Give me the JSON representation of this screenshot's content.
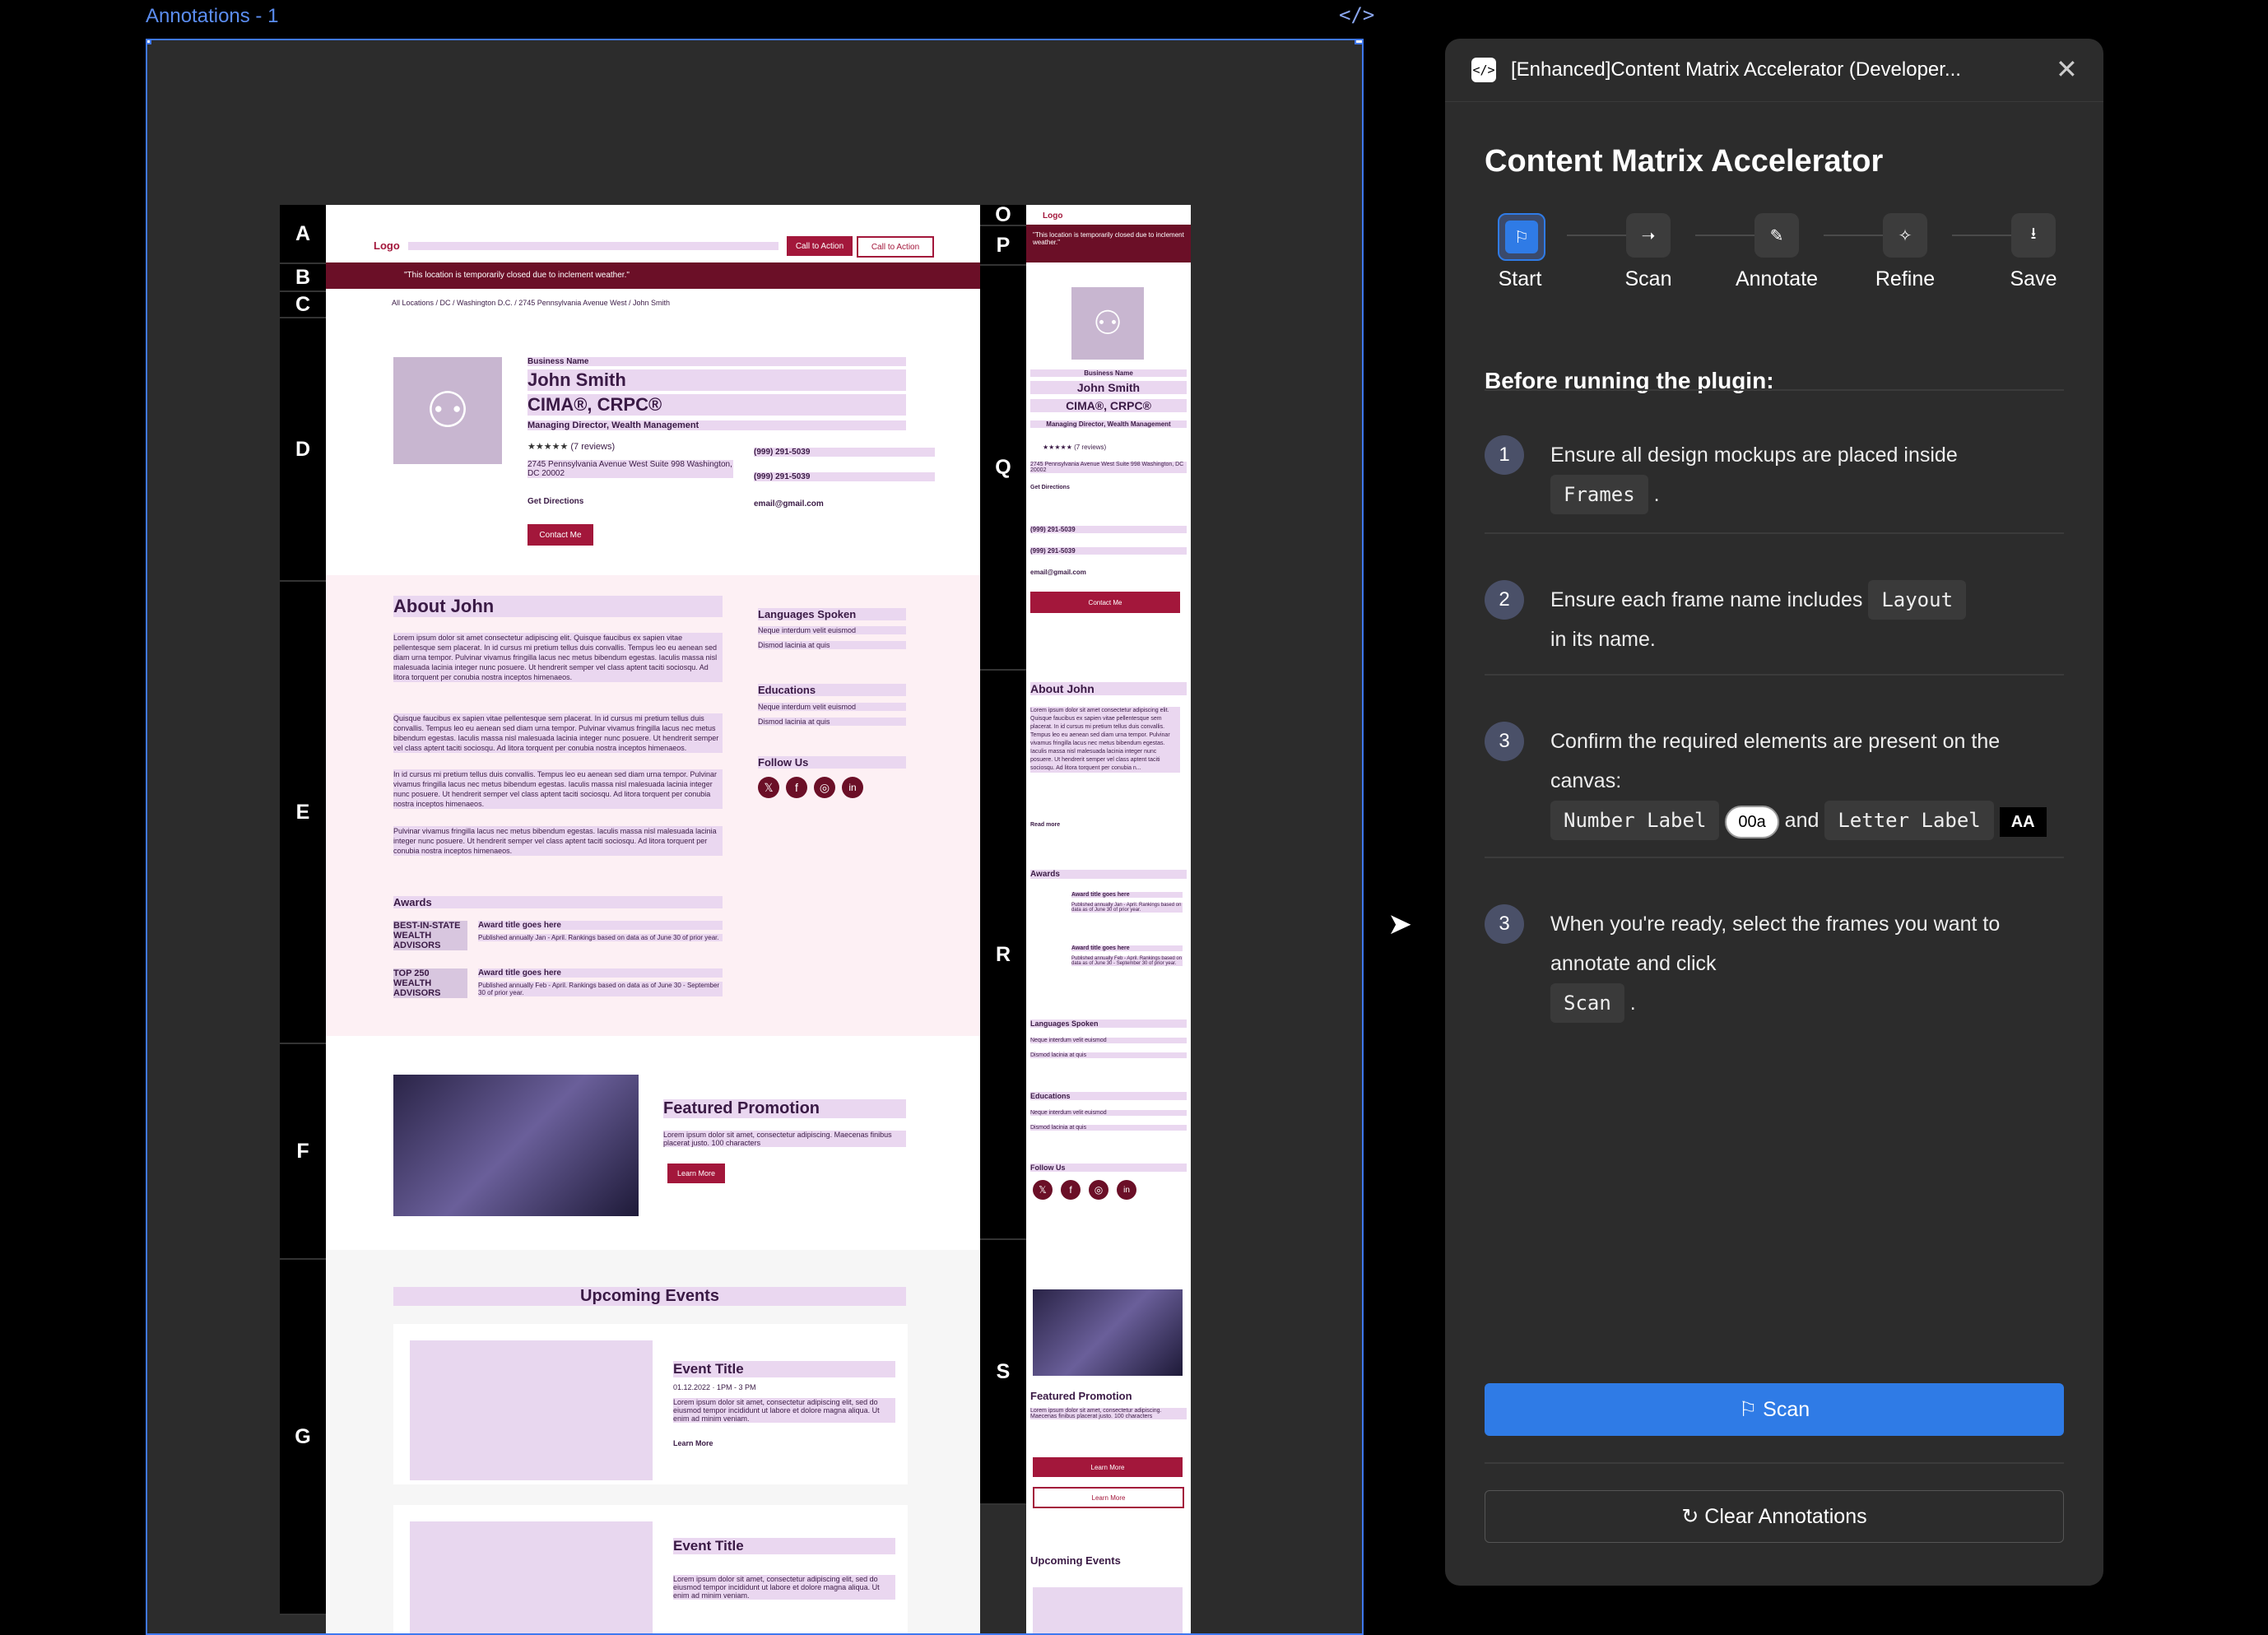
{
  "canvas": {
    "frame_label": "Annotations - 1",
    "code_toggle": "</>",
    "desktop_section_letters": [
      "A",
      "B",
      "C",
      "D",
      "E",
      "F",
      "G"
    ],
    "mobile_section_letters": [
      "O",
      "P",
      "Q",
      "R",
      "S"
    ],
    "desktop": {
      "logo": "Logo",
      "cta1": "Call to Action",
      "cta2": "Call to Action",
      "alert": "\"This location is temporarily closed due to inclement weather.\"",
      "breadcrumb": "All Locations / DC / Washington D.C. / 2745 Pennsylvania Avenue West / John Smith",
      "business_name": "Business Name",
      "person_name": "John Smith",
      "credentials": "CIMA®, CRPC®",
      "role": "Managing Director, Wealth Management",
      "reviews": "(7 reviews)",
      "address": "2745 Pennsylvania Avenue West Suite 998 Washington, DC 20002",
      "get_directions": "Get Directions",
      "phone1": "(999) 291-5039",
      "phone2": "(999) 291-5039",
      "email": "email@gmail.com",
      "contact_btn": "Contact Me",
      "about_title": "About John",
      "about_p1": "Lorem ipsum dolor sit amet consectetur adipiscing elit. Quisque faucibus ex sapien vitae pellentesque sem placerat. In id cursus mi pretium tellus duis convallis. Tempus leo eu aenean sed diam urna tempor. Pulvinar vivamus fringilla lacus nec metus bibendum egestas. Iaculis massa nisl malesuada lacinia integer nunc posuere. Ut hendrerit semper vel class aptent taciti sociosqu. Ad litora torquent per conubia nostra inceptos himenaeos.",
      "about_p2": "Quisque faucibus ex sapien vitae pellentesque sem placerat. In id cursus mi pretium tellus duis convallis. Tempus leo eu aenean sed diam urna tempor. Pulvinar vivamus fringilla lacus nec metus bibendum egestas. Iaculis massa nisl malesuada lacinia integer nunc posuere. Ut hendrerit semper vel class aptent taciti sociosqu. Ad litora torquent per conubia nostra inceptos himenaeos.",
      "about_p3": "In id cursus mi pretium tellus duis convallis. Tempus leo eu aenean sed diam urna tempor. Pulvinar vivamus fringilla lacus nec metus bibendum egestas. Iaculis massa nisl malesuada lacinia integer nunc posuere. Ut hendrerit semper vel class aptent taciti sociosqu. Ad litora torquent per conubia nostra inceptos himenaeos.",
      "about_p4": "Pulvinar vivamus fringilla lacus nec metus bibendum egestas. Iaculis massa nisl malesuada lacinia integer nunc posuere. Ut hendrerit semper vel class aptent taciti sociosqu. Ad litora torquent per conubia nostra inceptos himenaeos.",
      "languages_title": "Languages Spoken",
      "lang1": "Neque interdum velit euismod",
      "lang2": "Dismod lacinia at quis",
      "educations_title": "Educations",
      "edu1": "Neque interdum velit euismod",
      "edu2": "Dismod lacinia at quis",
      "follow_title": "Follow Us",
      "awards_title": "Awards",
      "award1_badge": "BEST-IN-STATE WEALTH ADVISORS",
      "award1_title": "Award title goes here",
      "award1_desc": "Published annually Jan - April. Rankings based on data as of June 30 of prior year.",
      "award2_badge": "TOP 250 WEALTH ADVISORS",
      "award2_title": "Award title goes here",
      "award2_desc": "Published annually Feb - April. Rankings based on data as of June 30 - September 30 of prior year.",
      "promo_title": "Featured Promotion",
      "promo_desc": "Lorem ipsum dolor sit amet, consectetur adipiscing. Maecenas finibus placerat justo. 100 characters",
      "promo_btn": "Learn More",
      "events_title": "Upcoming Events",
      "event_title": "Event Title",
      "event_date": "01.12.2022",
      "event_time": "1PM - 3 PM",
      "event_desc": "Lorem ipsum dolor sit amet, consectetur adipiscing elit, sed do eiusmod tempor incididunt ut labore et dolore magna aliqua. Ut enim ad minim veniam.",
      "event_link": "Learn More"
    },
    "mobile": {
      "logo": "Logo",
      "alert": "\"This location is temporarily closed due to inclement weather.\"",
      "business_name": "Business Name",
      "person_name": "John Smith",
      "credentials": "CIMA®, CRPC®",
      "role": "Managing Director, Wealth Management",
      "reviews": "(7 reviews)",
      "address": "2745 Pennsylvania Avenue West Suite 998 Washington, DC 20002",
      "get_directions": "Get Directions",
      "phone1": "(999) 291-5039",
      "phone2": "(999) 291-5039",
      "email": "email@gmail.com",
      "contact_btn": "Contact Me",
      "about_title": "About John",
      "about_p": "Lorem ipsum dolor sit amet consectetur adipiscing elit. Quisque faucibus ex sapien vitae pellentesque sem placerat. In id cursus mi pretium tellus duis convallis. Tempus leo eu aenean sed diam urna tempor. Pulvinar vivamus fringilla lacus nec metus bibendum egestas. Iaculis massa nisl malesuada lacinia integer nunc posuere. Ut hendrerit semper vel class aptent taciti sociosqu. Ad litora torquent per conubia n...",
      "read_more": "Read more",
      "awards_title": "Awards",
      "award1_title": "Award title goes here",
      "award1_desc": "Published annually Jan - April. Rankings based on data as of June 30 of prior year.",
      "award2_title": "Award title goes here",
      "award2_desc": "Published annually Feb - April. Rankings based on data as of June 30 - September 30 of prior year.",
      "languages_title": "Languages Spoken",
      "lang1": "Neque interdum velit euismod",
      "lang2": "Dismod lacinia at quis",
      "educations_title": "Educations",
      "edu1": "Neque interdum velit euismod",
      "edu2": "Dismod lacinia at quis",
      "follow_title": "Follow Us",
      "promo_title": "Featured Promotion",
      "promo_desc": "Lorem ipsum dolor sit amet, consectetur adipiscing. Maecenas finibus placerat justo. 100 characters",
      "promo_btn1": "Learn More",
      "promo_btn2": "Learn More",
      "events_title": "Upcoming Events"
    }
  },
  "plugin": {
    "window_title": "[Enhanced]Content Matrix Accelerator (Developer...",
    "heading": "Content Matrix Accelerator",
    "steps": [
      {
        "label": "Start",
        "icon": "flag-icon",
        "glyph": "⚐"
      },
      {
        "label": "Scan",
        "icon": "send-icon",
        "glyph": "➝"
      },
      {
        "label": "Annotate",
        "icon": "pencil-icon",
        "glyph": "✎"
      },
      {
        "label": "Refine",
        "icon": "sparkle-icon",
        "glyph": "✧"
      },
      {
        "label": "Save",
        "icon": "download-icon",
        "glyph": "⭳"
      }
    ],
    "active_step": "Start",
    "subheading": "Before running the plugin:",
    "item1": {
      "num": "1",
      "text": "Ensure all design mockups are placed inside",
      "chip": "Frames",
      "tail": "."
    },
    "item2": {
      "num": "2",
      "text": "Ensure each frame name includes",
      "chip": "Layout",
      "tail": "in its name."
    },
    "item3": {
      "num": "3",
      "text": "Confirm the required elements are present on the canvas:",
      "chip1": "Number Label",
      "badge1": "00a",
      "and": "and",
      "chip2": "Letter Label",
      "badge2": "AA"
    },
    "item4": {
      "num": "3",
      "text": "When you're ready, select the frames you want to annotate and click",
      "chip": "Scan",
      "tail": "."
    },
    "scan_button": "⚐ Scan",
    "clear_button": "↻ Clear Annotations",
    "colors": {
      "accent": "#2f7be6",
      "active_step": "#2f7be6",
      "brand_maroon": "#a3173b"
    }
  }
}
